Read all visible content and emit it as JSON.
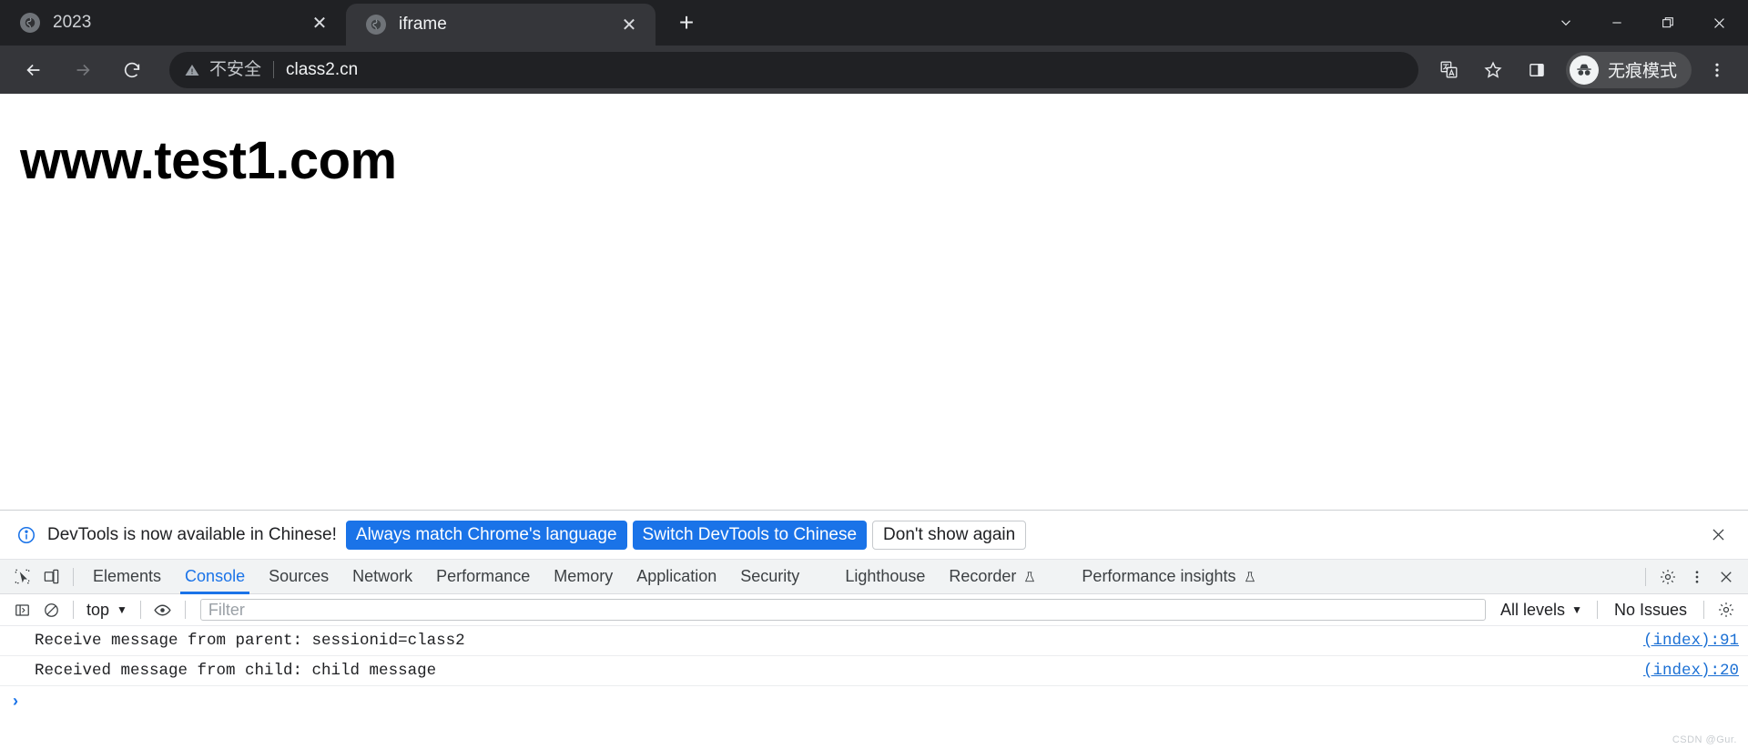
{
  "browser": {
    "tabs": [
      {
        "title": "2023",
        "favicon": "globe-icon",
        "active": false,
        "close_label": "✕"
      },
      {
        "title": "iframe",
        "favicon": "globe-icon",
        "active": true,
        "close_label": "✕"
      }
    ],
    "new_tab_label": "+",
    "window_controls": {
      "tab_search": "tab-search-icon",
      "minimize": "minimize-icon",
      "maximize": "maximize-icon",
      "close": "close-icon"
    },
    "toolbar": {
      "back": "back-arrow-icon",
      "forward": "forward-arrow-icon",
      "reload": "reload-icon",
      "security_text": "不安全",
      "url": "class2.cn",
      "translate": "translate-icon",
      "bookmark": "star-icon",
      "side_panel": "side-panel-icon",
      "incognito_label": "无痕模式",
      "menu": "three-dot-menu-icon"
    }
  },
  "page": {
    "heading": "www.test1.com"
  },
  "devtools": {
    "banner": {
      "message": "DevTools is now available in Chinese!",
      "primary_button": "Always match Chrome's language",
      "secondary_button": "Switch DevTools to Chinese",
      "dismiss_button": "Don't show again",
      "close": "✕"
    },
    "tabs": [
      {
        "label": "Elements",
        "active": false,
        "experimental": false
      },
      {
        "label": "Console",
        "active": true,
        "experimental": false
      },
      {
        "label": "Sources",
        "active": false,
        "experimental": false
      },
      {
        "label": "Network",
        "active": false,
        "experimental": false
      },
      {
        "label": "Performance",
        "active": false,
        "experimental": false
      },
      {
        "label": "Memory",
        "active": false,
        "experimental": false
      },
      {
        "label": "Application",
        "active": false,
        "experimental": false
      },
      {
        "label": "Security",
        "active": false,
        "experimental": false
      },
      {
        "label": "Lighthouse",
        "active": false,
        "experimental": false
      },
      {
        "label": "Recorder",
        "active": false,
        "experimental": true
      },
      {
        "label": "Performance insights",
        "active": false,
        "experimental": true
      }
    ],
    "console_toolbar": {
      "sidebar_toggle": "sidebar-toggle-icon",
      "clear_console": "clear-console-icon",
      "context": "top",
      "live_expression": "eye-icon",
      "filter_placeholder": "Filter",
      "filter_value": "",
      "levels": "All levels",
      "issues": "No Issues",
      "settings": "gear-icon"
    },
    "console_messages": [
      {
        "text": "Receive message from parent: sessionid=class2",
        "source": "(index):91"
      },
      {
        "text": "Received message from child: child message",
        "source": "(index):20"
      }
    ],
    "prompt_caret": "›"
  },
  "watermark": "CSDN @Gur.",
  "colors": {
    "chrome_dark": "#202124",
    "chrome_toolbar": "#35363a",
    "accent_blue": "#1a73e8",
    "devtools_bg": "#f1f3f4"
  }
}
